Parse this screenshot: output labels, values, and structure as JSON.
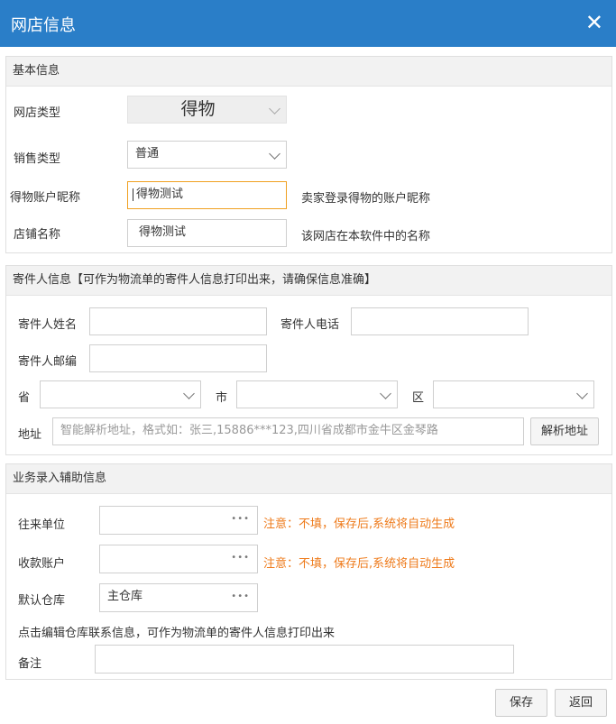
{
  "dialog": {
    "title": "网店信息"
  },
  "basic": {
    "header": "基本信息",
    "store_type_label": "网店类型",
    "store_type_value": "得物",
    "sale_type_label": "销售类型",
    "sale_type_value": "普通",
    "nickname_label": "得物账户昵称",
    "nickname_value": "得物测试",
    "nickname_hint": "卖家登录得物的账户昵称",
    "store_name_label": "店铺名称",
    "store_name_value": "得物测试",
    "store_name_hint": "该网店在本软件中的名称"
  },
  "sender": {
    "header": "寄件人信息【可作为物流单的寄件人信息打印出来，请确保信息准确】",
    "name_label": "寄件人姓名",
    "phone_label": "寄件人电话",
    "zip_label": "寄件人邮编",
    "province_label": "省",
    "city_label": "市",
    "district_label": "区",
    "address_label": "地址",
    "address_placeholder": "智能解析地址，格式如：张三,15886***123,四川省成都市金牛区金琴路",
    "parse_button": "解析地址"
  },
  "business": {
    "header": "业务录入辅助信息",
    "partner_label": "往来单位",
    "partner_note": "注意：不填，保存后,系统将自动生成",
    "account_label": "收款账户",
    "account_note": "注意：不填，保存后,系统将自动生成",
    "warehouse_label": "默认仓库",
    "warehouse_value": "主仓库",
    "warehouse_link": "点击编辑仓库联系信息，可作为物流单的寄件人信息打印出来",
    "remark_label": "备注"
  },
  "footer": {
    "save": "保存",
    "back": "返回"
  },
  "colors": {
    "titlebar": "#2a7ec8",
    "warning": "#ee7a1a",
    "focus_border": "#f0a020"
  },
  "icons": [
    "close-icon",
    "chevron-down-icon",
    "more-dots-icon"
  ]
}
